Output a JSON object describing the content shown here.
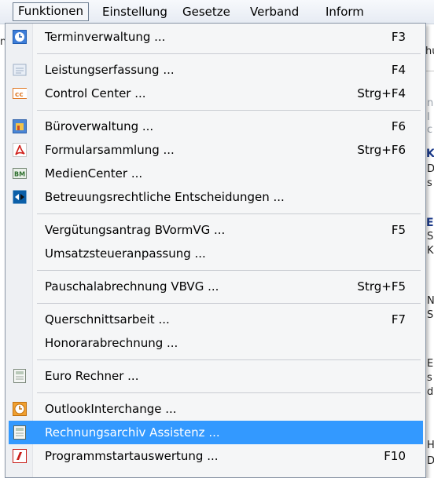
{
  "menubar": {
    "items": [
      {
        "label": "Funktionen"
      },
      {
        "label": "Einstellung"
      },
      {
        "label": "Gesetze"
      },
      {
        "label": "Verband"
      },
      {
        "label": "Inform"
      }
    ]
  },
  "background": {
    "left_fragment": "n",
    "right_fragments": [
      "hu",
      "n",
      "I",
      "c",
      "K",
      "D",
      "s",
      "E",
      "S",
      "K",
      "N",
      "S",
      "E",
      "s",
      "d",
      "H",
      "D"
    ]
  },
  "menu": {
    "items": [
      {
        "label": "Terminverwaltung ...",
        "shortcut": "F3",
        "icon": "clock-icon"
      },
      {
        "label": "Leistungserfassung ...",
        "shortcut": "F4",
        "icon": "list-icon"
      },
      {
        "label": "Control Center ...",
        "shortcut": "Strg+F4",
        "icon": "cc-icon"
      },
      {
        "label": "Büroverwaltung ...",
        "shortcut": "F6",
        "icon": "office-icon"
      },
      {
        "label": "Formularsammlung ...",
        "shortcut": "Strg+F6",
        "icon": "pdf-icon"
      },
      {
        "label": "MedienCenter ...",
        "shortcut": "",
        "icon": "media-icon"
      },
      {
        "label": "Betreuungsrechtliche Entscheidungen ...",
        "shortcut": "",
        "icon": "decision-icon"
      },
      {
        "label": "Vergütungsantrag BVormVG ...",
        "shortcut": "F5",
        "icon": ""
      },
      {
        "label": "Umsatzsteueranpassung ...",
        "shortcut": "",
        "icon": ""
      },
      {
        "label": "Pauschalabrechnung VBVG ...",
        "shortcut": "Strg+F5",
        "icon": ""
      },
      {
        "label": "Querschnittsarbeit ...",
        "shortcut": "F7",
        "icon": ""
      },
      {
        "label": "Honorarabrechnung ...",
        "shortcut": "",
        "icon": ""
      },
      {
        "label": "Euro Rechner ...",
        "shortcut": "",
        "icon": "calculator-icon"
      },
      {
        "label": "OutlookInterchange ...",
        "shortcut": "",
        "icon": "outlook-clock-icon"
      },
      {
        "label": "Rechnungsarchiv Assistenz ...",
        "shortcut": "",
        "icon": "archive-icon",
        "highlighted": true
      },
      {
        "label": "Programmstartauswertung ...",
        "shortcut": "F10",
        "icon": "report-icon"
      }
    ]
  },
  "colors": {
    "highlight": "#3399ff",
    "menu_bg": "#f5f6f7",
    "accent_blue": "#1b3a8a"
  }
}
